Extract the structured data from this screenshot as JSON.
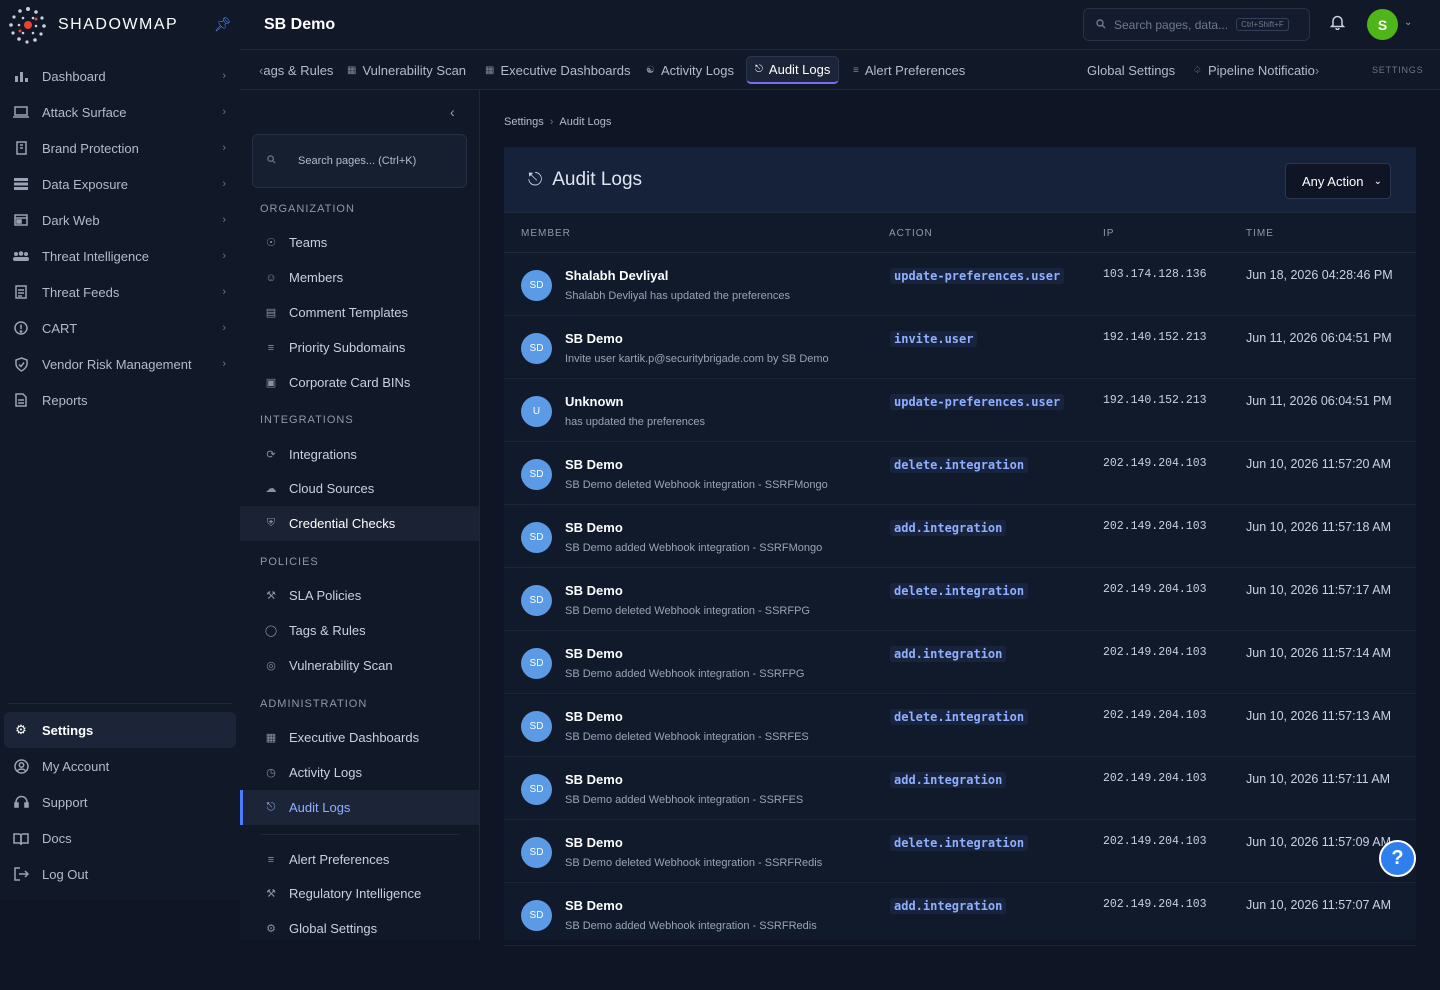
{
  "brand": {
    "name": "SHADOWMAP"
  },
  "sidebar": {
    "items": [
      {
        "label": "Dashboard",
        "icon": "bar-chart-icon"
      },
      {
        "label": "Attack Surface",
        "icon": "laptop-icon"
      },
      {
        "label": "Brand Protection",
        "icon": "building-icon"
      },
      {
        "label": "Data Exposure",
        "icon": "database-icon"
      },
      {
        "label": "Dark Web",
        "icon": "window-icon"
      },
      {
        "label": "Threat Intelligence",
        "icon": "users-icon"
      },
      {
        "label": "Threat Feeds",
        "icon": "feed-icon"
      },
      {
        "label": "CART",
        "icon": "alert-circle-icon"
      },
      {
        "label": "Vendor Risk Management",
        "icon": "shield-check-icon"
      },
      {
        "label": "Reports",
        "icon": "report-icon"
      }
    ],
    "bottom": [
      {
        "label": "Settings",
        "icon": "gear-icon"
      },
      {
        "label": "My Account",
        "icon": "user-circle-icon"
      },
      {
        "label": "Support",
        "icon": "headset-icon"
      },
      {
        "label": "Docs",
        "icon": "book-icon"
      },
      {
        "label": "Log Out",
        "icon": "logout-icon"
      }
    ]
  },
  "topbar": {
    "title": "SB Demo",
    "search_placeholder": "Search pages, data...",
    "search_shortcut": "Ctrl+Shift+F",
    "avatar": "S"
  },
  "tabs": [
    {
      "label": "ags & Rules",
      "prefix": "‹"
    },
    {
      "label": "Vulnerability Scan"
    },
    {
      "label": "Executive Dashboards"
    },
    {
      "label": "Activity Logs"
    },
    {
      "label": "Audit Logs"
    },
    {
      "label": "Alert Preferences"
    },
    {
      "label": "Global Settings"
    },
    {
      "label": "Pipeline Notificatio",
      "suffix": "›"
    }
  ],
  "tabs_section_label": "SETTINGS",
  "settings_panel": {
    "search_placeholder": "Search pages... (Ctrl+K)",
    "sections": {
      "organization": "ORGANIZATION",
      "integrations": "INTEGRATIONS",
      "policies": "POLICIES",
      "administration": "ADMINISTRATION"
    },
    "items": {
      "teams": "Teams",
      "members": "Members",
      "comment_templates": "Comment Templates",
      "priority_subdomains": "Priority Subdomains",
      "corporate_card_bins": "Corporate Card BINs",
      "integrations": "Integrations",
      "cloud_sources": "Cloud Sources",
      "credential_checks": "Credential Checks",
      "sla_policies": "SLA Policies",
      "tags_rules": "Tags & Rules",
      "vulnerability_scan": "Vulnerability Scan",
      "executive_dashboards": "Executive Dashboards",
      "activity_logs": "Activity Logs",
      "audit_logs": "Audit Logs",
      "alert_preferences": "Alert Preferences",
      "regulatory_intelligence": "Regulatory Intelligence",
      "global_settings": "Global Settings"
    }
  },
  "breadcrumb": {
    "root": "Settings",
    "current": "Audit Logs"
  },
  "audit": {
    "title": "Audit Logs",
    "filter": "Any Action",
    "columns": {
      "member": "MEMBER",
      "action": "ACTION",
      "ip": "IP",
      "time": "TIME"
    },
    "rows": [
      {
        "initials": "SD",
        "name": "Shalabh Devliyal",
        "desc": "Shalabh Devliyal has updated the preferences",
        "action": "update-preferences.user",
        "ip": "103.174.128.136",
        "time": "Jun 18, 2026 04:28:46 PM"
      },
      {
        "initials": "SD",
        "name": "SB Demo",
        "desc": "Invite user kartik.p@securitybrigade.com by SB Demo",
        "action": "invite.user",
        "ip": "192.140.152.213",
        "time": "Jun 11, 2026 06:04:51 PM"
      },
      {
        "initials": "U",
        "name": "Unknown",
        "desc": "has updated the preferences",
        "action": "update-preferences.user",
        "ip": "192.140.152.213",
        "time": "Jun 11, 2026 06:04:51 PM"
      },
      {
        "initials": "SD",
        "name": "SB Demo",
        "desc": "SB Demo deleted Webhook integration - SSRFMongo",
        "action": "delete.integration",
        "ip": "202.149.204.103",
        "time": "Jun 10, 2026 11:57:20 AM"
      },
      {
        "initials": "SD",
        "name": "SB Demo",
        "desc": "SB Demo added Webhook integration - SSRFMongo",
        "action": "add.integration",
        "ip": "202.149.204.103",
        "time": "Jun 10, 2026 11:57:18 AM"
      },
      {
        "initials": "SD",
        "name": "SB Demo",
        "desc": "SB Demo deleted Webhook integration - SSRFPG",
        "action": "delete.integration",
        "ip": "202.149.204.103",
        "time": "Jun 10, 2026 11:57:17 AM"
      },
      {
        "initials": "SD",
        "name": "SB Demo",
        "desc": "SB Demo added Webhook integration - SSRFPG",
        "action": "add.integration",
        "ip": "202.149.204.103",
        "time": "Jun 10, 2026 11:57:14 AM"
      },
      {
        "initials": "SD",
        "name": "SB Demo",
        "desc": "SB Demo deleted Webhook integration - SSRFES",
        "action": "delete.integration",
        "ip": "202.149.204.103",
        "time": "Jun 10, 2026 11:57:13 AM"
      },
      {
        "initials": "SD",
        "name": "SB Demo",
        "desc": "SB Demo added Webhook integration - SSRFES",
        "action": "add.integration",
        "ip": "202.149.204.103",
        "time": "Jun 10, 2026 11:57:11 AM"
      },
      {
        "initials": "SD",
        "name": "SB Demo",
        "desc": "SB Demo deleted Webhook integration - SSRFRedis",
        "action": "delete.integration",
        "ip": "202.149.204.103",
        "time": "Jun 10, 2026 11:57:09 AM"
      },
      {
        "initials": "SD",
        "name": "SB Demo",
        "desc": "SB Demo added Webhook integration - SSRFRedis",
        "action": "add.integration",
        "ip": "202.149.204.103",
        "time": "Jun 10, 2026 11:57:07 AM"
      }
    ]
  },
  "help_label": "?",
  "colors": {
    "accent": "#4f7cff",
    "avatar_green": "#4fb61a",
    "member_avatar": "#5b9be6",
    "tab_underline": "#7c6cf0"
  }
}
